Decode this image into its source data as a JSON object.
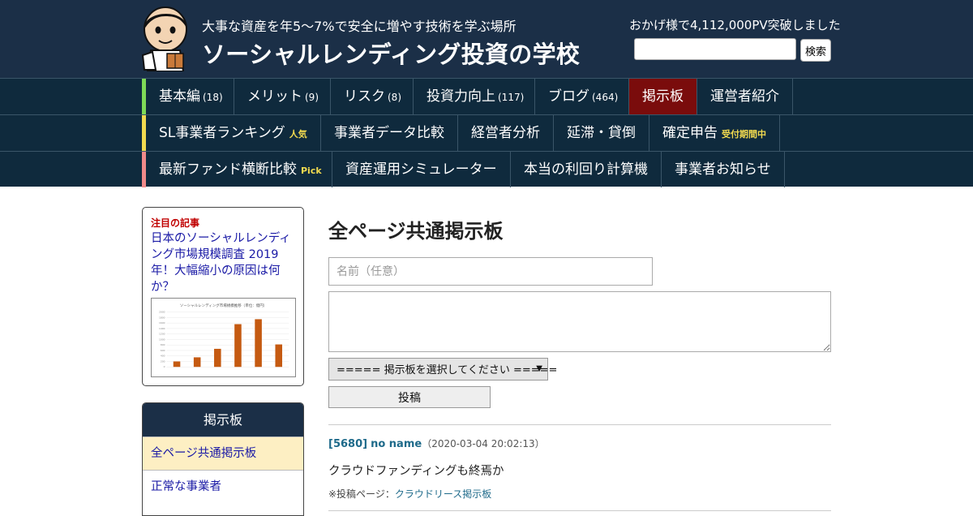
{
  "header": {
    "tagline": "大事な資産を年5～7%で安全に増やす技術を学ぶ場所",
    "site_title": "ソーシャルレンディング投資の学校",
    "pv_text": "おかげ様で4,112,000PV突破しました",
    "search_button": "検索",
    "search_value": ""
  },
  "nav": {
    "row1": [
      {
        "label": "基本編",
        "count": "(18)"
      },
      {
        "label": "メリット",
        "count": "(9)"
      },
      {
        "label": "リスク",
        "count": "(8)"
      },
      {
        "label": "投資力向上",
        "count": "(117)"
      },
      {
        "label": "ブログ",
        "count": "(464)"
      },
      {
        "label": "掲示板",
        "count": ""
      },
      {
        "label": "運営者紹介",
        "count": ""
      }
    ],
    "row2": [
      {
        "label": "SL事業者ランキング",
        "tag": "人気"
      },
      {
        "label": "事業者データ比較",
        "tag": ""
      },
      {
        "label": "経営者分析",
        "tag": ""
      },
      {
        "label": "延滞・貸倒",
        "tag": ""
      },
      {
        "label": "確定申告",
        "tag": "受付期間中"
      }
    ],
    "row3": [
      {
        "label": "最新ファンド横断比較",
        "tag": "Pick"
      },
      {
        "label": "資産運用シミュレーター",
        "tag": ""
      },
      {
        "label": "本当の利回り計算機",
        "tag": ""
      },
      {
        "label": "事業者お知らせ",
        "tag": ""
      }
    ],
    "active_item": "掲示板",
    "accent_colors": [
      "#7ed957",
      "#f2da4f",
      "#f08a8a"
    ]
  },
  "sidebar": {
    "featured_label": "注目の記事",
    "featured_title": "日本のソーシャルレンディング市場規模調査 2019年！大幅縮小の原因は何か？",
    "thumb_chart": {
      "type": "bar",
      "title": "ソーシャルレンディング市場規模推移（単位：億円）",
      "values": [
        200,
        350,
        660,
        1560,
        1740,
        820
      ],
      "ylim": [
        0,
        2000
      ],
      "ticks": [
        0,
        200,
        400,
        600,
        800,
        1000,
        1200,
        1400,
        1600,
        1800,
        2000
      ],
      "bar_color": "#c55a11"
    },
    "boards_title": "掲示板",
    "boards": [
      {
        "label": "全ページ共通掲示板",
        "current": true
      },
      {
        "label": "正常な事業者",
        "current": false
      }
    ]
  },
  "main": {
    "title": "全ページ共通掲示板",
    "name_placeholder": "名前（任意）",
    "message_value": "",
    "select_label": "===== 掲示板を選択してください =====",
    "post_button": "投稿",
    "post": {
      "id": "[5680]",
      "author": "no name",
      "date": "（2020-03-04 20:02:13）",
      "body": "クラウドファンディングも終焉か",
      "source_label": "※投稿ページ：",
      "source_link": "クラウドリース掲示板"
    }
  },
  "colors": {
    "header_bg": "#1b2f47",
    "nav_bg": "#0f2a3d",
    "active_nav": "#7a0c0c",
    "link": "#1a1aa6",
    "post_meta": "#1e6a8a",
    "highlight_row": "#fdefc3"
  }
}
